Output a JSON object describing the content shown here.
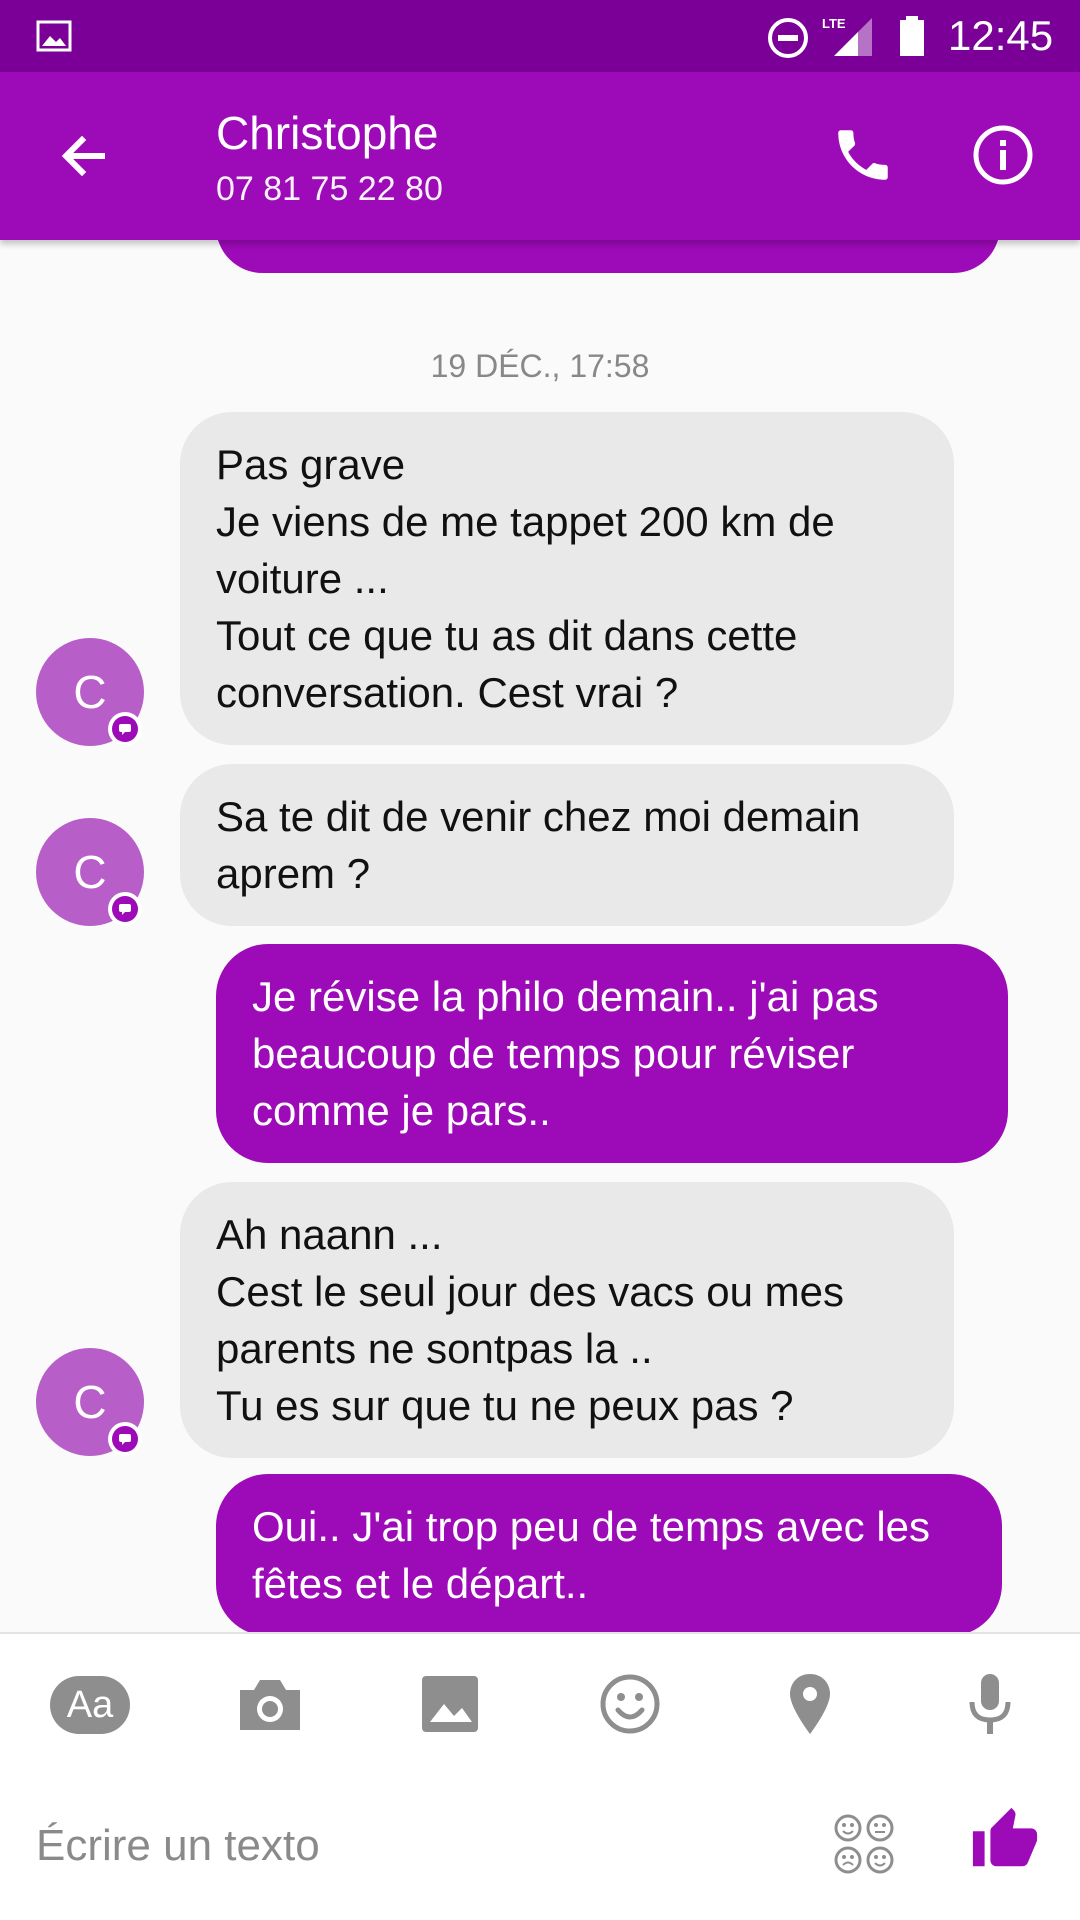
{
  "status_bar": {
    "time": "12:45",
    "network": "LTE"
  },
  "header": {
    "contact_name": "Christophe",
    "contact_phone": "07 81 75 22 80"
  },
  "conversation": {
    "date_separator": "19 DÉC., 17:58",
    "messages": [
      {
        "direction": "incoming",
        "avatar_initial": "C",
        "text": "Pas grave\nJe viens de me tappet 200 km de voiture ...\nTout ce que tu as dit dans cette conversation. Cest vrai ?"
      },
      {
        "direction": "incoming",
        "avatar_initial": "C",
        "text": "Sa te dit de venir chez moi demain aprem ?"
      },
      {
        "direction": "outgoing",
        "text": "Je révise la philo demain.. j'ai pas beaucoup de temps pour réviser comme je pars.."
      },
      {
        "direction": "incoming",
        "avatar_initial": "C",
        "text": "Ah naann ...\nCest le seul jour des vacs ou mes parents ne sontpas la ..\nTu es sur que tu ne peux pas ?"
      },
      {
        "direction": "outgoing",
        "text": "Oui.. J'ai trop peu de temps avec les fêtes et le départ.."
      }
    ]
  },
  "toolbar": {
    "text_format_label": "Aa",
    "icons": [
      "camera-icon",
      "gallery-icon",
      "emoji-icon",
      "location-icon",
      "microphone-icon"
    ]
  },
  "composer": {
    "placeholder": "Écrire un texto"
  },
  "colors": {
    "status_bar": "#7a0097",
    "app_bar": "#9d0ab8",
    "outgoing_bubble": "#9d0ab8",
    "incoming_bubble": "#e9e9e9",
    "avatar": "#b75ec9"
  }
}
